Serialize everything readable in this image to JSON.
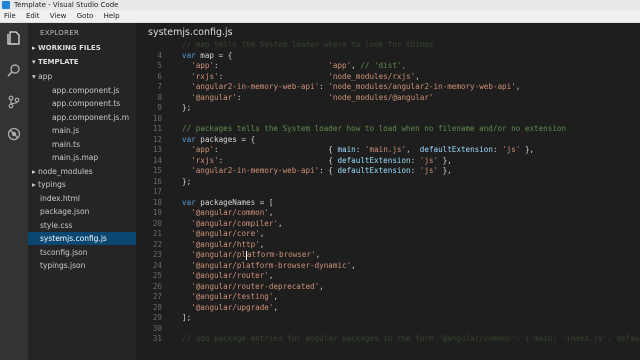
{
  "window": {
    "title": "Template - Visual Studio Code"
  },
  "menu": [
    "File",
    "Edit",
    "View",
    "Goto",
    "Help"
  ],
  "activity_icons": [
    "files-icon",
    "search-icon",
    "git-icon",
    "debug-icon"
  ],
  "explorer": {
    "header": "EXPLORER",
    "working_files": "WORKING FILES",
    "project": "TEMPLATE",
    "items": [
      {
        "label": "app",
        "type": "folder",
        "indent": 1,
        "open": true
      },
      {
        "label": "app.component.js",
        "indent": 2
      },
      {
        "label": "app.component.ts",
        "indent": 2
      },
      {
        "label": "app.component.js.m",
        "indent": 2
      },
      {
        "label": "main.js",
        "indent": 2
      },
      {
        "label": "main.ts",
        "indent": 2
      },
      {
        "label": "main.js.map",
        "indent": 2
      },
      {
        "label": "node_modules",
        "type": "folder",
        "indent": 1,
        "open": false
      },
      {
        "label": "typings",
        "type": "folder",
        "indent": 1,
        "open": false
      },
      {
        "label": "index.html",
        "indent": 1
      },
      {
        "label": "package.json",
        "indent": 1
      },
      {
        "label": "style.css",
        "indent": 1
      },
      {
        "label": "systemjs.config.js",
        "indent": 1,
        "selected": true
      },
      {
        "label": "tsconfig.json",
        "indent": 1
      },
      {
        "label": "typings.json",
        "indent": 1
      }
    ]
  },
  "editor": {
    "tab": "systemjs.config.js",
    "lines": [
      {
        "n": "",
        "html": "<span class='cmt'>// map tells the System loader where to look for things</span>",
        "partial": true
      },
      {
        "n": "4",
        "html": "<span class='kw'>var</span> map = {"
      },
      {
        "n": "5",
        "html": "  <span class='str'>'app'</span>:                        <span class='str'>'app'</span>, <span class='cmt'>// 'dist',</span>"
      },
      {
        "n": "6",
        "html": "  <span class='str'>'rxjs'</span>:                       <span class='str'>'node_modules/rxjs'</span>,"
      },
      {
        "n": "7",
        "html": "  <span class='str'>'angular2-in-memory-web-api'</span>: <span class='str'>'node_modules/angular2-in-memory-web-api'</span>,"
      },
      {
        "n": "8",
        "html": "  <span class='str'>'@angular'</span>:                   <span class='str'>'node_modules/@angular'</span>"
      },
      {
        "n": "9",
        "html": "};"
      },
      {
        "n": "10",
        "html": ""
      },
      {
        "n": "11",
        "html": "<span class='cmt'>// packages tells the System loader how to load when no filename and/or no extension</span>"
      },
      {
        "n": "12",
        "html": "<span class='kw'>var</span> packages = {"
      },
      {
        "n": "13",
        "html": "  <span class='str'>'app'</span>:                        { <span class='prop'>main</span>: <span class='str'>'main.js'</span>,  <span class='prop'>defaultExtension</span>: <span class='str'>'js'</span> },"
      },
      {
        "n": "14",
        "html": "  <span class='str'>'rxjs'</span>:                       { <span class='prop'>defaultExtension</span>: <span class='str'>'js'</span> },"
      },
      {
        "n": "15",
        "html": "  <span class='str'>'angular2-in-memory-web-api'</span>: { <span class='prop'>defaultExtension</span>: <span class='str'>'js'</span> },"
      },
      {
        "n": "16",
        "html": "};"
      },
      {
        "n": "17",
        "html": ""
      },
      {
        "n": "18",
        "html": "<span class='kw'>var</span> packageNames = ["
      },
      {
        "n": "19",
        "html": "  <span class='str'>'@angular/common'</span>,"
      },
      {
        "n": "20",
        "html": "  <span class='str'>'@angular/compiler'</span>,"
      },
      {
        "n": "21",
        "html": "  <span class='str'>'@angular/core'</span>,"
      },
      {
        "n": "22",
        "html": "  <span class='str'>'@angular/http'</span>,"
      },
      {
        "n": "23",
        "html": "  <span class='str'>'@angular/pl<span class=\"caret\"></span>atform-browser'</span>,"
      },
      {
        "n": "24",
        "html": "  <span class='str'>'@angular/platform-browser-dynamic'</span>,"
      },
      {
        "n": "25",
        "html": "  <span class='str'>'@angular/router'</span>,"
      },
      {
        "n": "26",
        "html": "  <span class='str'>'@angular/router-deprecated'</span>,"
      },
      {
        "n": "27",
        "html": "  <span class='str'>'@angular/testing'</span>,"
      },
      {
        "n": "28",
        "html": "  <span class='str'>'@angular/upgrade'</span>,"
      },
      {
        "n": "29",
        "html": "];"
      },
      {
        "n": "30",
        "html": ""
      },
      {
        "n": "31",
        "html": "<span class='cmt'>// add package entries for angular packages in the form '@angular/common': { main: 'index.js', defaultExt</span>",
        "partial": true
      }
    ]
  }
}
